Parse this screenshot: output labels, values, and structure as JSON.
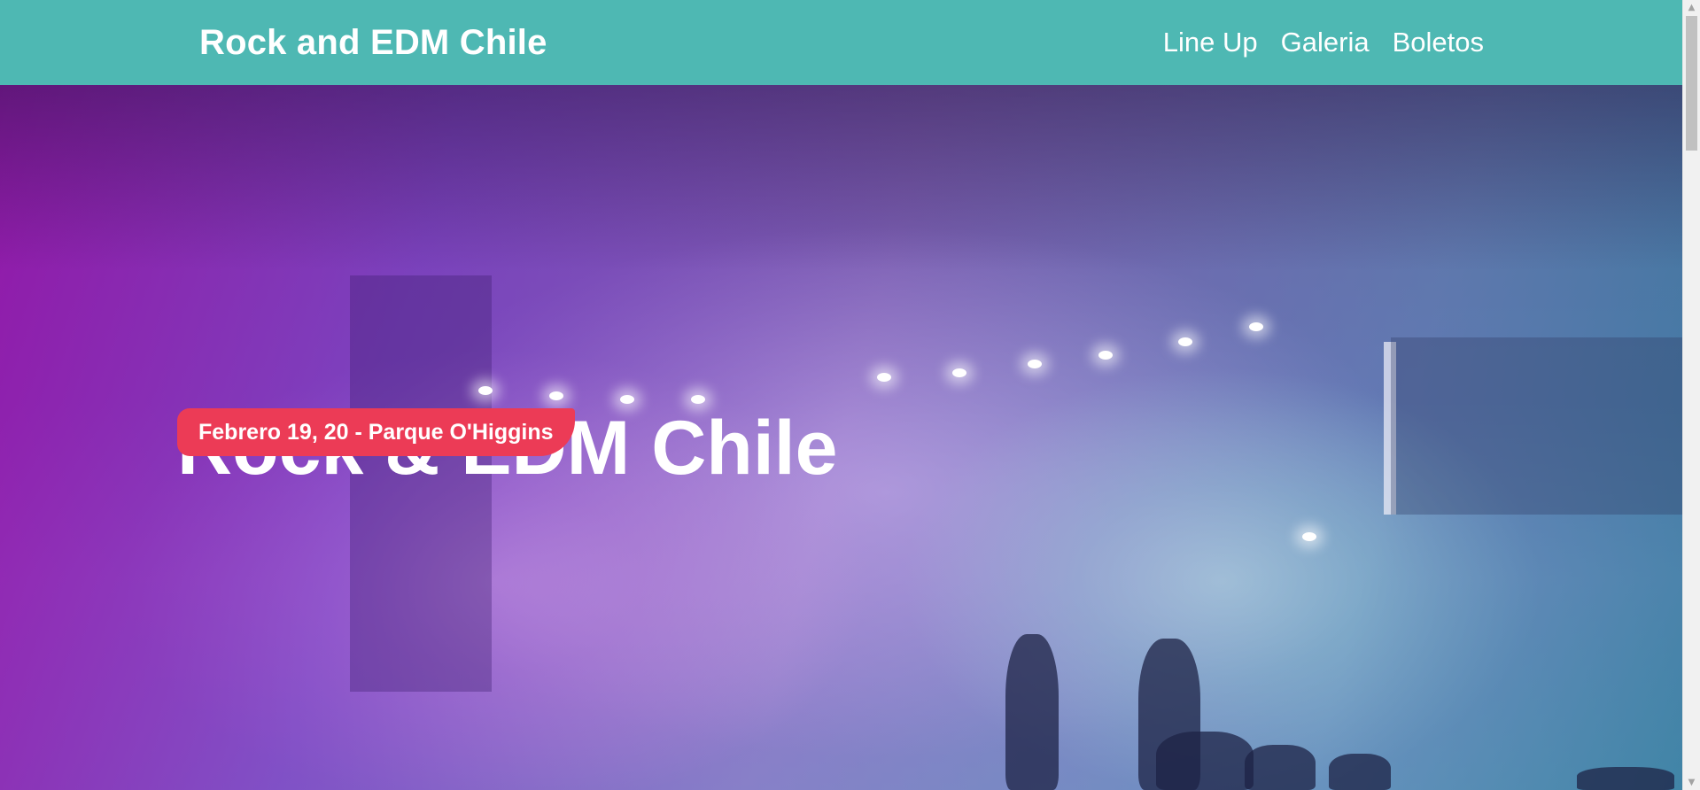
{
  "header": {
    "logo": "Rock and EDM Chile",
    "nav": [
      {
        "label": "Line Up"
      },
      {
        "label": "Galeria"
      },
      {
        "label": "Boletos"
      }
    ],
    "background_color": "#4eb8b3"
  },
  "hero": {
    "title": "Rock & EDM Chile",
    "badge": "Febrero 19, 20 - Parque O'Higgins",
    "badge_color": "#ec3b56",
    "background": "concert-stage-photo with purple-to-teal gradient overlay"
  },
  "scrollbar": {
    "up_icon": "scroll-up-arrow-icon",
    "down_icon": "scroll-down-arrow-icon"
  }
}
